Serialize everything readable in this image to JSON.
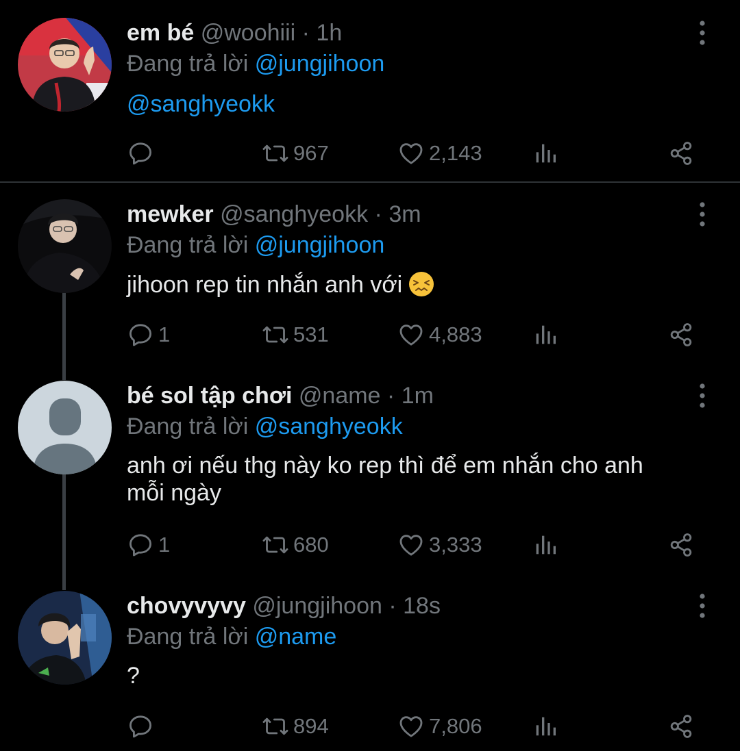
{
  "tweets": [
    {
      "name": "em bé",
      "handle": "@woohiii",
      "dot": "·",
      "time": "1h",
      "reply_prefix": "Đang trả lời",
      "reply_to": "@jungjihoon",
      "text": "@sanghyeokk",
      "replies": "",
      "retweets": "967",
      "likes": "2,143"
    },
    {
      "name": "mewker",
      "handle": "@sanghyeokk",
      "dot": "·",
      "time": "3m",
      "reply_prefix": "Đang trả lời",
      "reply_to": "@jungjihoon",
      "text": "jihoon rep tin nhắn anh với",
      "emoji": "confounded-face",
      "replies": "1",
      "retweets": "531",
      "likes": "4,883"
    },
    {
      "name": "bé sol tập chơi",
      "handle": "@name",
      "dot": "·",
      "time": "1m",
      "reply_prefix": "Đang trả lời",
      "reply_to": "@sanghyeokk",
      "text_line1": "anh ơi nếu thg này ko rep thì để em nhắn cho anh",
      "text_line2": "mỗi ngày",
      "replies": "1",
      "retweets": "680",
      "likes": "3,333"
    },
    {
      "name": "chovyvyvy",
      "handle": "@jungjihoon",
      "dot": "·",
      "time": "18s",
      "reply_prefix": "Đang trả lời",
      "reply_to": "@name",
      "text": "?",
      "replies": "",
      "retweets": "894",
      "likes": "7,806"
    }
  ],
  "icons": {
    "reply": "reply-icon",
    "retweet": "retweet-icon",
    "like": "heart-icon",
    "views": "views-icon",
    "share": "share-icon",
    "more": "more-vertical-icon"
  },
  "colors": {
    "background": "#000000",
    "text": "#e7e9ea",
    "muted": "#71767b",
    "mention": "#1d9bf0"
  }
}
